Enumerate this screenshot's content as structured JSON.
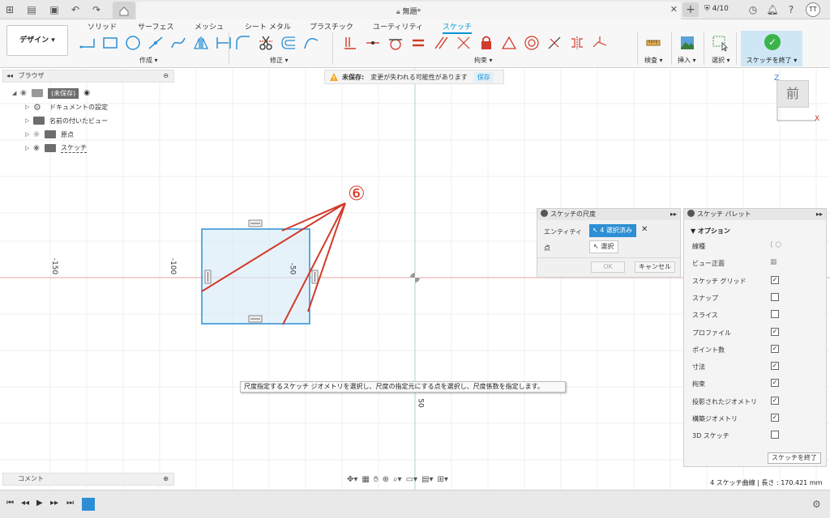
{
  "app": {
    "doc_title": "無題*",
    "jobs": "4/10",
    "user_initials": "TT"
  },
  "ribbon": {
    "workspace_button": "デザイン ▾",
    "tabs": [
      "ソリッド",
      "サーフェス",
      "メッシュ",
      "シート メタル",
      "プラスチック",
      "ユーティリティ",
      "スケッチ"
    ],
    "groups": {
      "create": "作成 ▾",
      "modify": "修正 ▾",
      "constraints": "拘束 ▾",
      "inspect": "検査 ▾",
      "insert": "挿入 ▾",
      "select": "選択 ▾"
    },
    "finish_sketch": "スケッチを終了 ▾"
  },
  "warning": {
    "label": "未保存:",
    "message": "変更が失われる可能性があります",
    "save": "保存"
  },
  "browser": {
    "title": "ブラウザ",
    "root": "(未保存)",
    "items": [
      "ドキュメントの設定",
      "名前の付いたビュー",
      "原点",
      "スケッチ"
    ]
  },
  "comments": {
    "title": "コメント"
  },
  "axis_labels": {
    "x1": "-150",
    "x2": "-100",
    "x3": "-50",
    "y1": "50"
  },
  "annotation": "⑥",
  "view_cube": {
    "face": "前",
    "z": "Z",
    "x": "X"
  },
  "dim_dialog": {
    "title": "スケッチの尺度",
    "entity_label": "エンティティ",
    "entity_value": "4 選択済み",
    "point_label": "点",
    "point_value": "選択",
    "ok": "OK",
    "cancel": "キャンセル"
  },
  "palette": {
    "title": "スケッチ パレット",
    "options_header": "▼ オプション",
    "rows": [
      {
        "label": "線種",
        "kind": "icon"
      },
      {
        "label": "ビュー正面",
        "kind": "icon"
      },
      {
        "label": "スケッチ グリッド",
        "checked": true
      },
      {
        "label": "スナップ",
        "checked": false
      },
      {
        "label": "スライス",
        "checked": false
      },
      {
        "label": "プロファイル",
        "checked": true
      },
      {
        "label": "ポイント数",
        "checked": true
      },
      {
        "label": "寸法",
        "checked": true
      },
      {
        "label": "拘束",
        "checked": true
      },
      {
        "label": "投影されたジオメトリ",
        "checked": true
      },
      {
        "label": "構築ジオメトリ",
        "checked": true
      },
      {
        "label": "3D スケッチ",
        "checked": false
      }
    ],
    "finish": "スケッチを終了"
  },
  "tooltip": "尺度指定するスケッチ ジオメトリを選択し、尺度の指定元にする点を選択し、尺度係数を指定します。",
  "status": "4 スケッチ曲線 | 長さ : 170.421 mm",
  "colors": {
    "accent": "#0696d7",
    "annotation": "#d23a2a",
    "sketch_blue": "#2c8fd4"
  }
}
